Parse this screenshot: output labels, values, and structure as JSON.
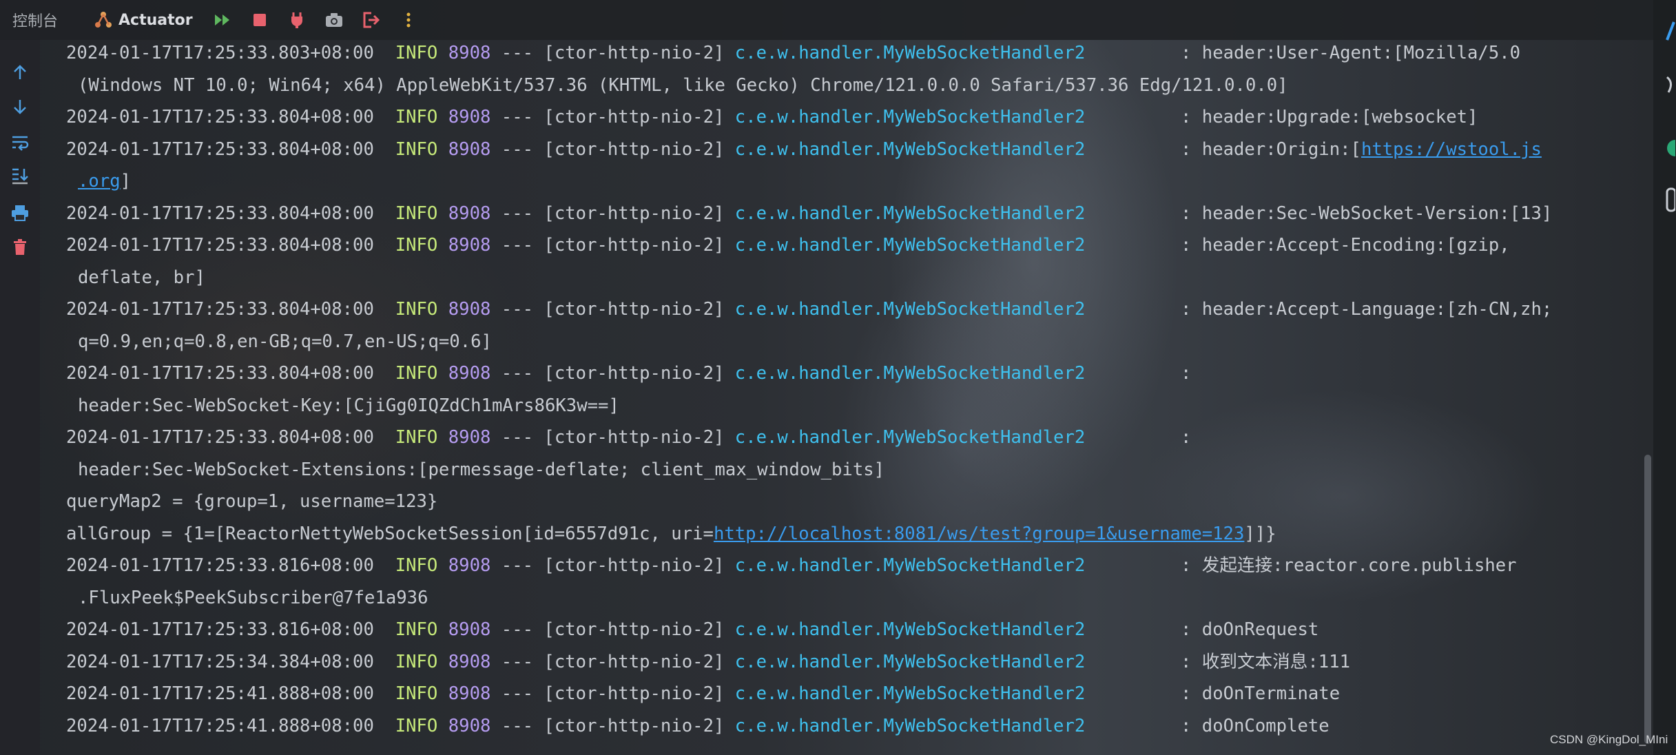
{
  "toolbar": {
    "console_tab": "控制台",
    "actuator_tab": "Actuator"
  },
  "icons": {
    "actuator": "actuator-icon",
    "resume": "fast-forward-icon",
    "stop": "stop-icon",
    "plug": "plug-icon",
    "camera": "camera-icon",
    "exit": "exit-icon",
    "more": "more-vertical-icon",
    "up": "arrow-up-icon",
    "down": "arrow-down-icon",
    "wrap": "soft-wrap-icon",
    "scroll_end": "scroll-to-end-icon",
    "print": "print-icon",
    "clear": "trash-icon"
  },
  "colors": {
    "info_level": "#c6e97a",
    "pid": "#b59cf0",
    "logger_class": "#3fc0ee",
    "link": "#3a9cee",
    "stop_red": "#e8626d",
    "accent_green": "#5fb85f"
  },
  "log": {
    "lines": [
      {
        "ts": "2024-01-17T17:25:33.803+08:00",
        "lvl": "INFO",
        "pid": "8908",
        "thread": " --- [ctor-http-nio-2] ",
        "cls": "c.e.w.handler.MyWebSocketHandler2",
        "sep": "         : ",
        "msg": "header:User-Agent:[Mozilla/5.0"
      },
      {
        "cont": "(Windows NT 10.0; Win64; x64) AppleWebKit/537.36 (KHTML, like Gecko) Chrome/121.0.0.0 Safari/537.36 Edg/121.0.0.0]"
      },
      {
        "ts": "2024-01-17T17:25:33.804+08:00",
        "lvl": "INFO",
        "pid": "8908",
        "thread": " --- [ctor-http-nio-2] ",
        "cls": "c.e.w.handler.MyWebSocketHandler2",
        "sep": "         : ",
        "msg": "header:Upgrade:[websocket]"
      },
      {
        "ts": "2024-01-17T17:25:33.804+08:00",
        "lvl": "INFO",
        "pid": "8908",
        "thread": " --- [ctor-http-nio-2] ",
        "cls": "c.e.w.handler.MyWebSocketHandler2",
        "sep": "         : ",
        "msg": "header:Origin:[",
        "link": "https://wstool.js"
      },
      {
        "cont_link": ".org",
        "cont": "]"
      },
      {
        "ts": "2024-01-17T17:25:33.804+08:00",
        "lvl": "INFO",
        "pid": "8908",
        "thread": " --- [ctor-http-nio-2] ",
        "cls": "c.e.w.handler.MyWebSocketHandler2",
        "sep": "         : ",
        "msg": "header:Sec-WebSocket-Version:[13]"
      },
      {
        "ts": "2024-01-17T17:25:33.804+08:00",
        "lvl": "INFO",
        "pid": "8908",
        "thread": " --- [ctor-http-nio-2] ",
        "cls": "c.e.w.handler.MyWebSocketHandler2",
        "sep": "         : ",
        "msg": "header:Accept-Encoding:[gzip,"
      },
      {
        "cont": "deflate, br]"
      },
      {
        "ts": "2024-01-17T17:25:33.804+08:00",
        "lvl": "INFO",
        "pid": "8908",
        "thread": " --- [ctor-http-nio-2] ",
        "cls": "c.e.w.handler.MyWebSocketHandler2",
        "sep": "         : ",
        "msg": "header:Accept-Language:[zh-CN,zh;"
      },
      {
        "cont": "q=0.9,en;q=0.8,en-GB;q=0.7,en-US;q=0.6]"
      },
      {
        "ts": "2024-01-17T17:25:33.804+08:00",
        "lvl": "INFO",
        "pid": "8908",
        "thread": " --- [ctor-http-nio-2] ",
        "cls": "c.e.w.handler.MyWebSocketHandler2",
        "sep": "         :",
        "msg": ""
      },
      {
        "cont": "header:Sec-WebSocket-Key:[CjiGg0IQZdCh1mArs86K3w==]"
      },
      {
        "ts": "2024-01-17T17:25:33.804+08:00",
        "lvl": "INFO",
        "pid": "8908",
        "thread": " --- [ctor-http-nio-2] ",
        "cls": "c.e.w.handler.MyWebSocketHandler2",
        "sep": "         :",
        "msg": ""
      },
      {
        "cont": "header:Sec-WebSocket-Extensions:[permessage-deflate; client_max_window_bits]"
      },
      {
        "plain": "queryMap2 = {group=1, username=123}"
      },
      {
        "plain": "allGroup = {1=[ReactorNettyWebSocketSession[id=6557d91c, uri=",
        "link": "http://localhost:8081/ws/test?group=1&username=123",
        "after": "]]}"
      },
      {
        "ts": "2024-01-17T17:25:33.816+08:00",
        "lvl": "INFO",
        "pid": "8908",
        "thread": " --- [ctor-http-nio-2] ",
        "cls": "c.e.w.handler.MyWebSocketHandler2",
        "sep": "         : ",
        "msg": "发起连接:reactor.core.publisher"
      },
      {
        "cont": ".FluxPeek$PeekSubscriber@7fe1a936"
      },
      {
        "ts": "2024-01-17T17:25:33.816+08:00",
        "lvl": "INFO",
        "pid": "8908",
        "thread": " --- [ctor-http-nio-2] ",
        "cls": "c.e.w.handler.MyWebSocketHandler2",
        "sep": "         : ",
        "msg": "doOnRequest"
      },
      {
        "ts": "2024-01-17T17:25:34.384+08:00",
        "lvl": "INFO",
        "pid": "8908",
        "thread": " --- [ctor-http-nio-2] ",
        "cls": "c.e.w.handler.MyWebSocketHandler2",
        "sep": "         : ",
        "msg": "收到文本消息:111"
      },
      {
        "ts": "2024-01-17T17:25:41.888+08:00",
        "lvl": "INFO",
        "pid": "8908",
        "thread": " --- [ctor-http-nio-2] ",
        "cls": "c.e.w.handler.MyWebSocketHandler2",
        "sep": "         : ",
        "msg": "doOnTerminate"
      },
      {
        "ts": "2024-01-17T17:25:41.888+08:00",
        "lvl": "INFO",
        "pid": "8908",
        "thread": " --- [ctor-http-nio-2] ",
        "cls": "c.e.w.handler.MyWebSocketHandler2",
        "sep": "         : ",
        "msg": "doOnComplete"
      }
    ]
  },
  "watermark": "CSDN @KingDol_MIni"
}
